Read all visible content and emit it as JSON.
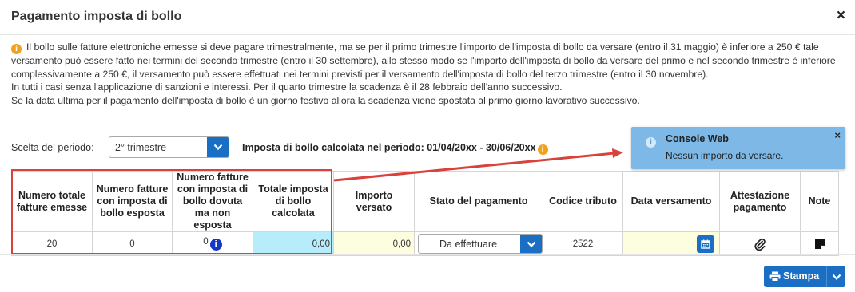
{
  "dialog": {
    "title": "Pagamento imposta di bollo",
    "close_label": "×"
  },
  "info": {
    "paragraph1": "Il bollo sulle fatture elettroniche emesse si deve pagare trimestralmente, ma se per il primo trimestre l'importo dell'imposta di bollo da versare (entro il 31 maggio) è inferiore a 250 € tale versamento può essere fatto nei termini del secondo trimestre (entro il 30 settembre), allo stesso modo se l'importo dell'imposta di bollo da versare del primo e nel secondo trimestre è inferiore complessivamente a 250 €, il versamento può essere effettuati nei termini previsti per il versamento dell'imposta di bollo del terzo trimestre (entro il 30 novembre).",
    "paragraph2": "In tutti i casi senza l'applicazione di sanzioni e interessi. Per il quarto trimestre la scadenza è il 28 febbraio dell'anno successivo.",
    "paragraph3": "Se la data ultima per il pagamento dell'imposta di bollo è un giorno festivo allora la scadenza viene spostata al primo giorno lavorativo successivo."
  },
  "period": {
    "label": "Scelta del periodo:",
    "selected": "2° trimestre"
  },
  "calc": {
    "text": "Imposta di bollo calcolata nel periodo: 01/04/20",
    "xx1": "xx",
    "middle": " - 30/06/20",
    "xx2": "xx"
  },
  "table": {
    "headers": [
      "Numero totale fatture emesse",
      "Numero fatture con imposta di bollo esposta",
      "Numero fatture con imposta di bollo dovuta ma non esposta",
      "Totale imposta di bollo calcolata",
      "Importo versato",
      "Stato del pagamento",
      "Codice tributo",
      "Data versamento",
      "Attestazione pagamento",
      "Note"
    ],
    "row": {
      "total_invoices": "20",
      "invoices_with_stamp": "0",
      "invoices_stamp_due": "0",
      "total_stamp_calculated": "0,00",
      "amount_paid": "0,00",
      "payment_status": "Da effettuare",
      "tax_code": "2522",
      "payment_date": ""
    }
  },
  "toast": {
    "title": "Console Web",
    "message": "Nessun importo da versare.",
    "close_label": "×"
  },
  "footer": {
    "print_label": "Stampa"
  },
  "colors": {
    "primary": "#1a6fc4",
    "highlight_red": "#d9423b",
    "calc_cell": "#b7ecfb",
    "editable_cell": "#fdfde0",
    "toast_bg": "#7db8e6",
    "info_orange": "#f0a21c"
  },
  "icons": {
    "info": "info-circle-icon",
    "dropdown": "chevron-down-icon",
    "calendar": "calendar-icon",
    "attachment": "paperclip-icon",
    "note": "sticky-note-icon",
    "print": "printer-icon",
    "close": "close-icon"
  }
}
